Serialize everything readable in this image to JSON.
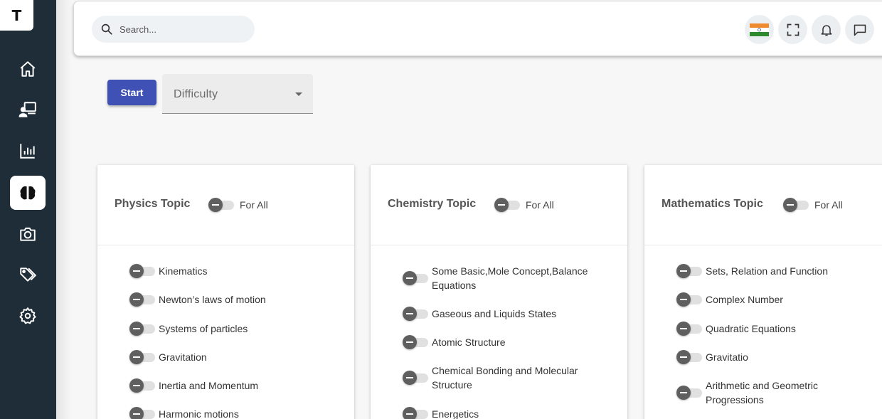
{
  "app": {
    "logo_letter": "T"
  },
  "sidebar": {
    "items": [
      {
        "icon": "home-icon",
        "active": false
      },
      {
        "icon": "classroom-icon",
        "active": false
      },
      {
        "icon": "chart-bars-icon",
        "active": false
      },
      {
        "icon": "brain-icon",
        "active": true
      },
      {
        "icon": "camera-icon",
        "active": false
      },
      {
        "icon": "tags-icon",
        "active": false
      },
      {
        "icon": "gear-icon",
        "active": false
      }
    ]
  },
  "header": {
    "search_placeholder": "Search...",
    "buttons": [
      "india-flag-icon",
      "fullscreen-icon",
      "bell-icon",
      "chat-icon"
    ]
  },
  "controls": {
    "start_label": "Start",
    "difficulty_label": "Difficulty"
  },
  "cards": [
    {
      "title": "Physics Topic",
      "for_all": "For All",
      "topics": [
        "Kinematics",
        "Newton’s laws of motion",
        "Systems of particles",
        "Gravitation",
        "Inertia and Momentum",
        "Harmonic motions"
      ]
    },
    {
      "title": "Chemistry Topic",
      "for_all": "For All",
      "topics": [
        "Some Basic,Mole Concept,Balance Equations",
        "Gaseous and Liquids States",
        "Atomic Structure",
        "Chemical Bonding and Molecular Structure",
        "Energetics"
      ]
    },
    {
      "title": "Mathematics Topic",
      "for_all": "For All",
      "topics": [
        "Sets, Relation and Function",
        "Complex Number",
        "Quadratic Equations",
        "Gravitatio",
        "Arithmetic and Geometric Progressions"
      ]
    }
  ],
  "colors": {
    "sidebar": "#1f2d38",
    "accent": "#3f51b5",
    "toggle_knob": "#5f5f5f"
  }
}
